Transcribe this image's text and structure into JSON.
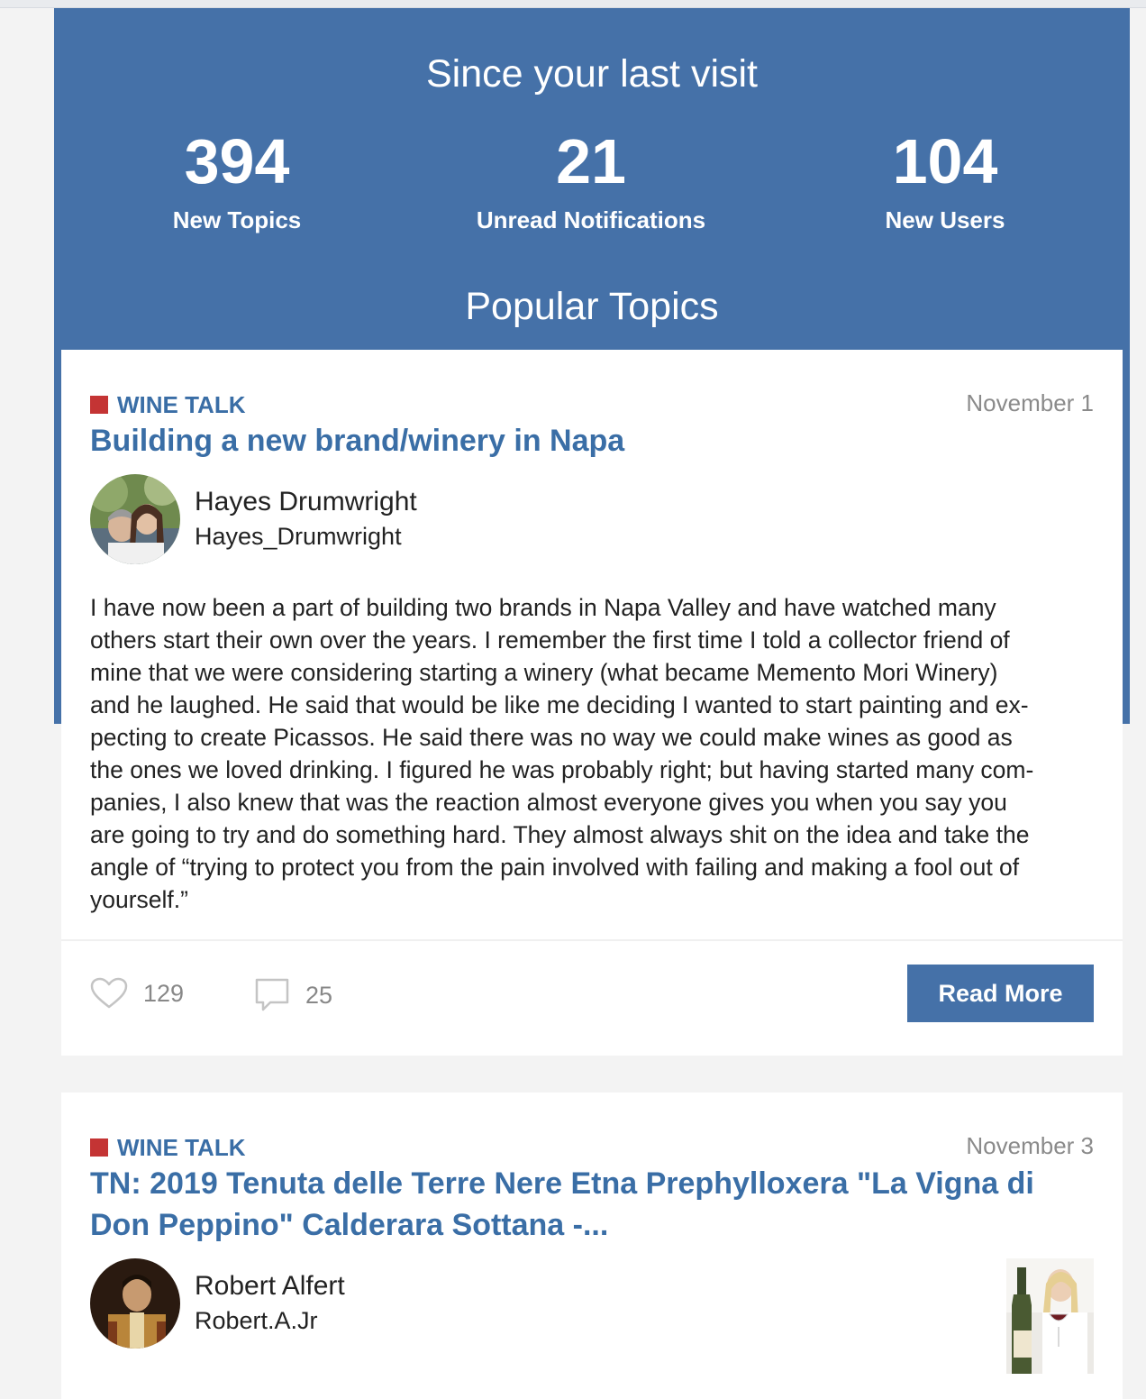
{
  "header": {
    "title": "Since your last visit",
    "stats": [
      {
        "value": "394",
        "label": "New Topics"
      },
      {
        "value": "21",
        "label": "Unread Notifications"
      },
      {
        "value": "104",
        "label": "New Users"
      }
    ],
    "section_title": "Popular Topics"
  },
  "topics": [
    {
      "category": "WINE TALK",
      "date": "November 1",
      "title": "Building a new brand/winery in Napa",
      "author_name": "Hayes Drumwright",
      "author_username": "Hayes_Drumwright",
      "excerpt_lines": [
        "I have now been a part of building two brands in Napa Valley and have watched many",
        "others start their own over the years. I remember the first time I told a collector friend of",
        "mine that we were considering starting a winery (what became Memento Mori Winery)",
        "and he laughed. He said that would be like me deciding I wanted to start painting and ex-",
        "pecting to create Picassos. He said there was no way we could make wines as good as",
        "the ones we loved drinking. I figured he was probably right; but having started many com-",
        "panies, I also knew that was the reaction almost everyone gives you when you say you",
        "are going to try and do something hard. They almost always shit on the idea and take the",
        "angle of “trying to protect you from the pain involved with failing and making a fool out of",
        "yourself.”"
      ],
      "likes": "129",
      "comments": "25",
      "read_more": "Read More"
    },
    {
      "category": "WINE TALK",
      "date": "November 3",
      "title_lines": [
        "TN: 2019 Tenuta delle Terre Nere Etna Prephylloxera \"La Vigna di",
        "Don Peppino\" Calderara Sottana -..."
      ],
      "author_name": "Robert Alfert",
      "author_username": "Robert.A.Jr"
    }
  ],
  "icons": {
    "like": "heart-outline-icon",
    "comment": "speech-bubble-icon",
    "category": "red-square-icon"
  },
  "colors": {
    "brand_blue": "#4571a8",
    "link_blue": "#3a6ea6",
    "category_red": "#c43434"
  }
}
